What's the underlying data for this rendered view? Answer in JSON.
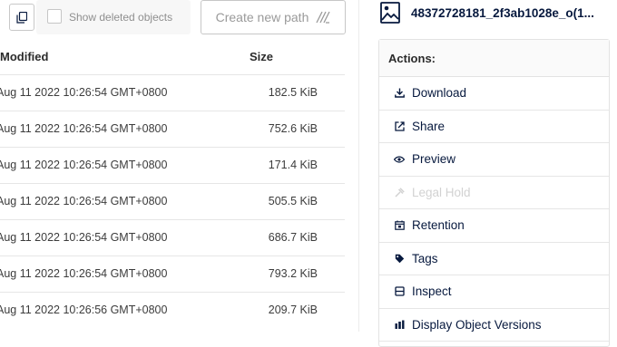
{
  "toolbar": {
    "copy_icon": "copy-icon",
    "show_deleted_label": "Show deleted objects",
    "show_deleted_checked": false,
    "create_path_label": "Create new path",
    "create_path_icon": "new-path-icon"
  },
  "table": {
    "headers": {
      "modified": "Modified",
      "size": "Size"
    },
    "rows": [
      {
        "modified": "Aug 11 2022 10:26:54 GMT+0800",
        "size": "182.5 KiB"
      },
      {
        "modified": "Aug 11 2022 10:26:54 GMT+0800",
        "size": "752.6 KiB"
      },
      {
        "modified": "Aug 11 2022 10:26:54 GMT+0800",
        "size": "171.4 KiB"
      },
      {
        "modified": "Aug 11 2022 10:26:54 GMT+0800",
        "size": "505.5 KiB"
      },
      {
        "modified": "Aug 11 2022 10:26:54 GMT+0800",
        "size": "686.7 KiB"
      },
      {
        "modified": "Aug 11 2022 10:26:54 GMT+0800",
        "size": "793.2 KiB"
      },
      {
        "modified": "Aug 11 2022 10:26:56 GMT+0800",
        "size": "209.7 KiB"
      }
    ]
  },
  "details": {
    "object_name": "48372728181_2f3ab1028e_o(1...",
    "object_icon": "image-file-icon",
    "actions_title": "Actions:",
    "actions": [
      {
        "label": "Download",
        "icon": "download-icon",
        "enabled": true
      },
      {
        "label": "Share",
        "icon": "share-icon",
        "enabled": true
      },
      {
        "label": "Preview",
        "icon": "eye-icon",
        "enabled": true
      },
      {
        "label": "Legal Hold",
        "icon": "gavel-icon",
        "enabled": false
      },
      {
        "label": "Retention",
        "icon": "calendar-icon",
        "enabled": true
      },
      {
        "label": "Tags",
        "icon": "tag-icon",
        "enabled": true
      },
      {
        "label": "Inspect",
        "icon": "inspect-icon",
        "enabled": true
      },
      {
        "label": "Display Object Versions",
        "icon": "versions-icon",
        "enabled": true
      }
    ]
  },
  "colors": {
    "primary_text": "#07193e",
    "disabled_text": "#d2d2d2",
    "border": "#e3e3e3"
  }
}
